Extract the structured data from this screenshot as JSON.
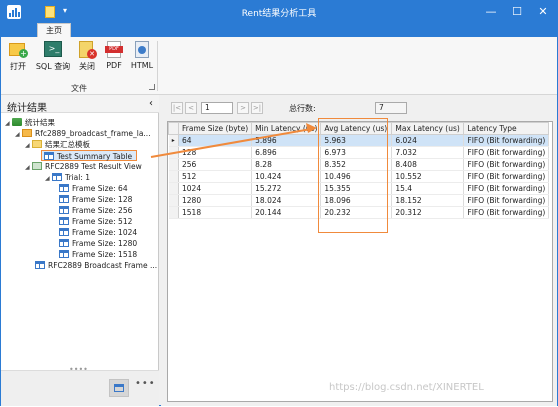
{
  "window": {
    "title": "Rent结果分析工具",
    "minimize_glyph": "—",
    "maximize_glyph": "☐",
    "close_glyph": "✕"
  },
  "quick_access": {
    "dropdown_glyph": "▾"
  },
  "ribbon": {
    "tab": "主页",
    "buttons": [
      {
        "label": "打开",
        "icon": "open-folder-icon"
      },
      {
        "label": "SQL 查询",
        "icon": "sql-console-icon"
      },
      {
        "label": "关闭",
        "icon": "close-file-icon"
      },
      {
        "label": "PDF",
        "icon": "pdf-icon"
      },
      {
        "label": "HTML",
        "icon": "html-icon"
      }
    ],
    "group_label": "文件"
  },
  "left_panel": {
    "title": "统计结果",
    "collapse_glyph": "‹",
    "tree": {
      "root": "统计结果",
      "file": "Rfc2889_broadcast_frame_la...",
      "folder": "结果汇总模板",
      "summary_table": "Test Summary Table",
      "result_view": "RFC2889 Test Result View",
      "trial": "Trial: 1",
      "frames": [
        "Frame Size: 64",
        "Frame Size: 128",
        "Frame Size: 256",
        "Frame Size: 512",
        "Frame Size: 1024",
        "Frame Size: 1280",
        "Frame Size: 1518"
      ],
      "broadcast": "RFC2889 Broadcast Frame ..."
    },
    "grip": "••••",
    "more_glyph": "•••"
  },
  "right_panel": {
    "nav": {
      "first": "|<",
      "prev": "<",
      "page": "1",
      "next": ">",
      "last": ">|",
      "total_label": "总行数:",
      "total_value": "7"
    },
    "table": {
      "columns": [
        "Frame Size (byte)",
        "Min Latency (us)",
        "Avg Latency (us)",
        "Max Latency (us)",
        "Latency Type"
      ],
      "rows": [
        [
          "64",
          "5.896",
          "5.963",
          "6.024",
          "FIFO (Bit forwarding)"
        ],
        [
          "128",
          "6.896",
          "6.973",
          "7.032",
          "FIFO (Bit forwarding)"
        ],
        [
          "256",
          "8.28",
          "8.352",
          "8.408",
          "FIFO (Bit forwarding)"
        ],
        [
          "512",
          "10.424",
          "10.496",
          "10.552",
          "FIFO (Bit forwarding)"
        ],
        [
          "1024",
          "15.272",
          "15.355",
          "15.4",
          "FIFO (Bit forwarding)"
        ],
        [
          "1280",
          "18.024",
          "18.096",
          "18.152",
          "FIFO (Bit forwarding)"
        ],
        [
          "1518",
          "20.144",
          "20.232",
          "20.312",
          "FIFO (Bit forwarding)"
        ]
      ],
      "row_indicator": "▸"
    }
  },
  "watermark": "https://blog.csdn.net/XINERTEL",
  "colors": {
    "titlebar": "#2b7bd4",
    "highlight": "#f08a3c",
    "selected_row": "#cfe3f7"
  }
}
